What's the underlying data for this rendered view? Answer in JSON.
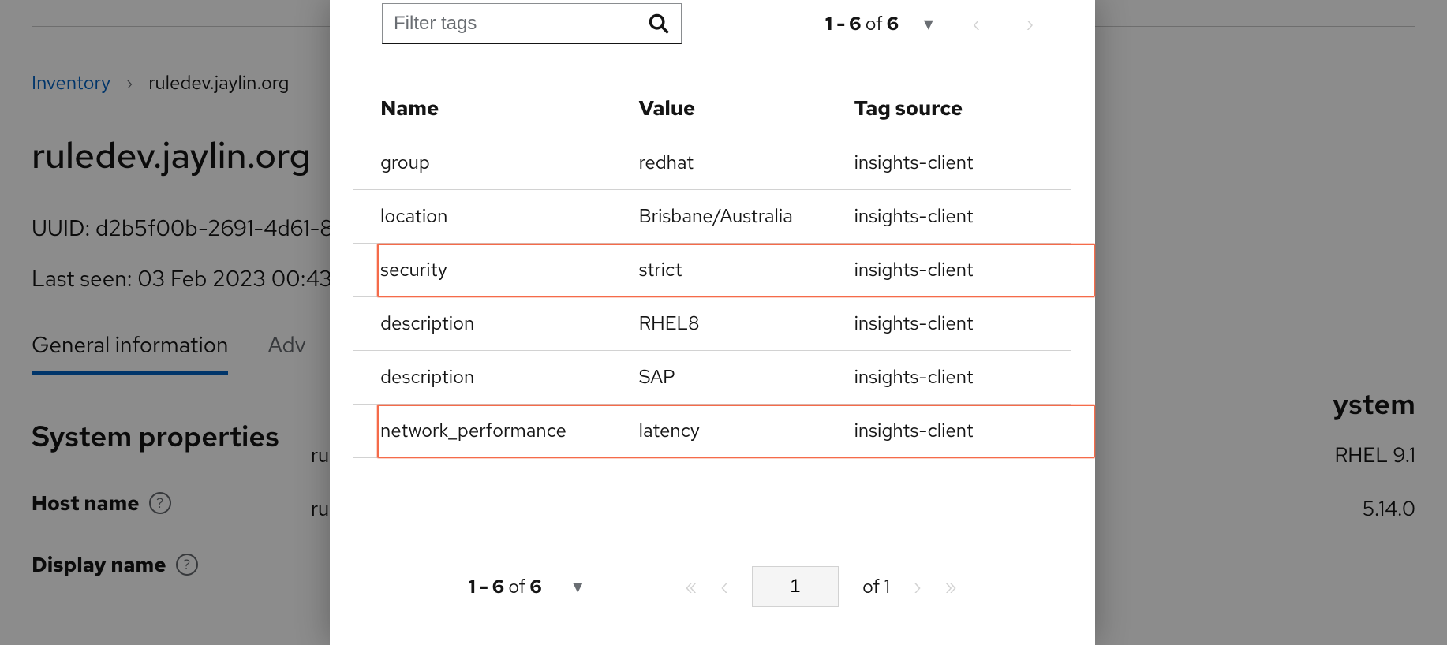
{
  "breadcrumb": {
    "root": "Inventory",
    "current": "ruledev.jaylin.org"
  },
  "page": {
    "title": "ruledev.jaylin.org",
    "uuid_label": "UUID:",
    "uuid_value": "d2b5f00b-2691-4d61-8",
    "last_seen_label": "Last seen:",
    "last_seen_value": "03 Feb 2023 00:43"
  },
  "tabs": {
    "general": "General information",
    "advisor_partial": "Adv"
  },
  "section": {
    "heading": "System properties",
    "rows": [
      {
        "label": "Host name",
        "value_partial": "ru"
      },
      {
        "label": "Display name",
        "value_partial": "ru"
      }
    ]
  },
  "right": {
    "heading_partial": "ystem",
    "value1": "RHEL 9.1",
    "value2": "5.14.0"
  },
  "modal": {
    "filter_placeholder": "Filter tags",
    "top_range": "1 - 6 of 6",
    "columns": {
      "name": "Name",
      "value": "Value",
      "source": "Tag source"
    },
    "rows": [
      {
        "name": "group",
        "value": "redhat",
        "source": "insights-client",
        "highlight": false
      },
      {
        "name": "location",
        "value": "Brisbane/Australia",
        "source": "insights-client",
        "highlight": false
      },
      {
        "name": "security",
        "value": "strict",
        "source": "insights-client",
        "highlight": true
      },
      {
        "name": "description",
        "value": "RHEL8",
        "source": "insights-client",
        "highlight": false
      },
      {
        "name": "description",
        "value": "SAP",
        "source": "insights-client",
        "highlight": false
      },
      {
        "name": "network_performance",
        "value": "latency",
        "source": "insights-client",
        "highlight": true
      }
    ],
    "pager": {
      "range": "1 - 6 of 6",
      "current_page": "1",
      "total_pages_label": "of 1"
    }
  }
}
